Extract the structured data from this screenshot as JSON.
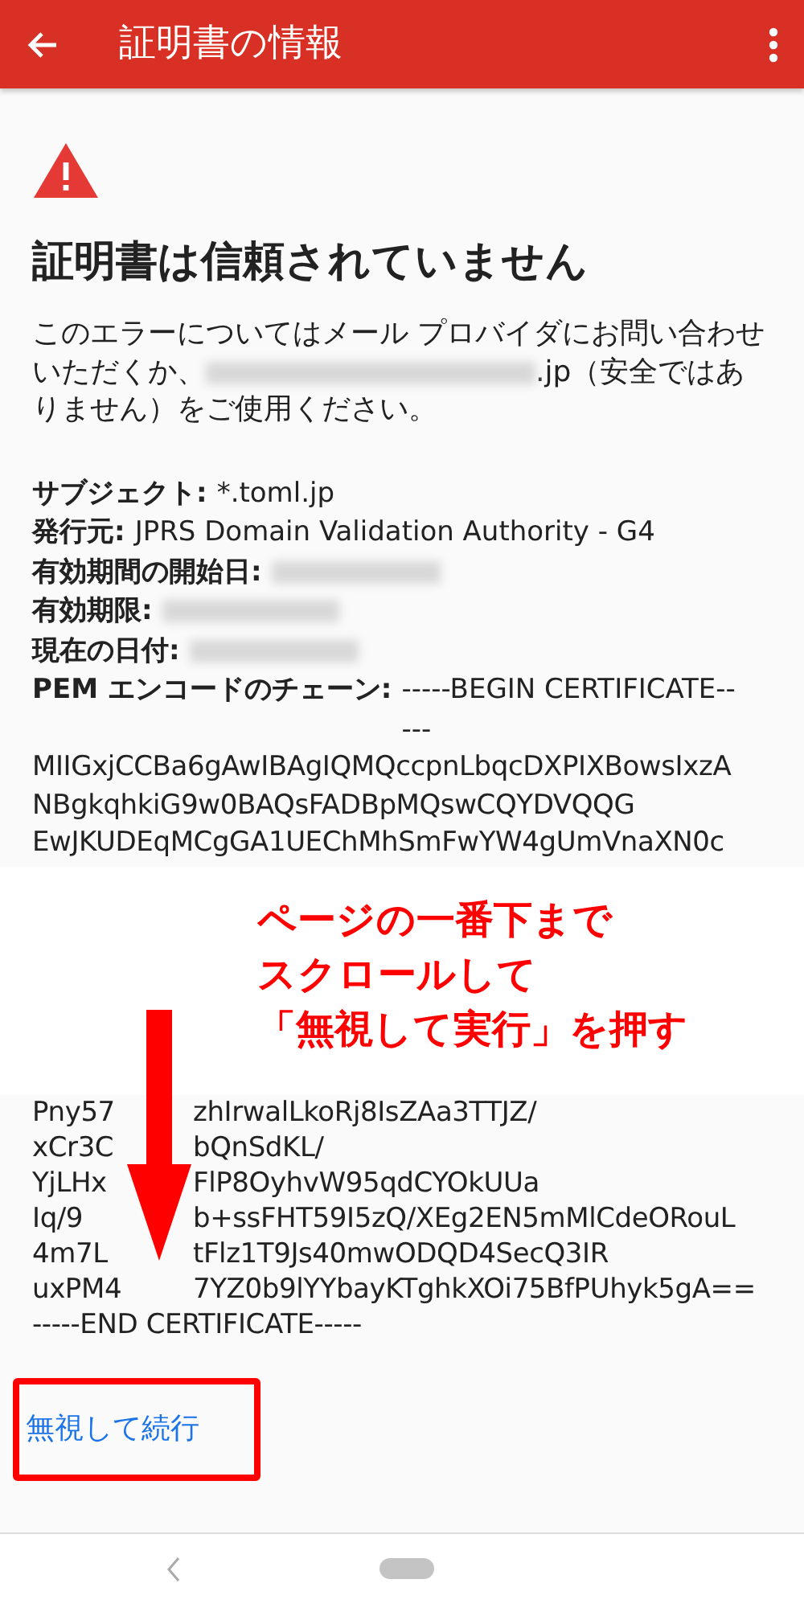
{
  "app_bar": {
    "title": "証明書の情報"
  },
  "heading": "証明書は信頼されていません",
  "message": {
    "before": "このエラーについてはメール プロバイダにお問い合わせいただくか、",
    "after": ".jp（安全ではありません）をご使用ください。"
  },
  "details": [
    {
      "label": "サブジェクト:",
      "kind": "text",
      "value": "*.toml.jp"
    },
    {
      "label": "発行元:",
      "kind": "text",
      "value": "JPRS Domain Validation Authority - G4"
    },
    {
      "label": "有効期間の開始日:",
      "kind": "blurred"
    },
    {
      "label": "有効期限:",
      "kind": "blurred"
    },
    {
      "label": "現在の日付:",
      "kind": "blurred"
    },
    {
      "label": "PEM エンコードのチェーン:",
      "kind": "text",
      "value": "-----BEGIN CERTIFICATE-----"
    }
  ],
  "certificate_top": [
    "MIIGxjCCBa6gAwIBAgIQMQccpnLbqcDXPIXBowsIxzA",
    "NBgkqhkiG9w0BAQsFADBpMQswCQYDVQQG",
    "EwJKUDEqMCgGA1UEChMhSmFwYW4gUmVnaXN0c"
  ],
  "annotation": [
    "ページの一番下まで",
    "スクロールして",
    "「無視して実行」を押す"
  ],
  "certificate_bottom": [
    {
      "left": "Pny57",
      "right": "zhIrwalLkoRj8IsZAa3TTJZ/"
    },
    {
      "left": "xCr3C",
      "right": "bQnSdKL/"
    },
    {
      "left": "YjLHx",
      "right": "FlP8OyhvW95qdCYOkUUa"
    },
    {
      "left": "Iq/9",
      "right": "b+ssFHT59I5zQ/XEg2EN5mMlCdeORouL"
    },
    {
      "left": "4m7L",
      "right": "tFlz1T9Js40mwODQD4SecQ3IR"
    },
    {
      "left": "uxPM4",
      "right": "7YZ0b9lYYbayKTghkXOi75BfPUhyk5gA=="
    },
    {
      "left": "-----END CERTIFICATE-----"
    }
  ],
  "proceed_button": {
    "label": "無視して続行",
    "highlighted": true
  }
}
